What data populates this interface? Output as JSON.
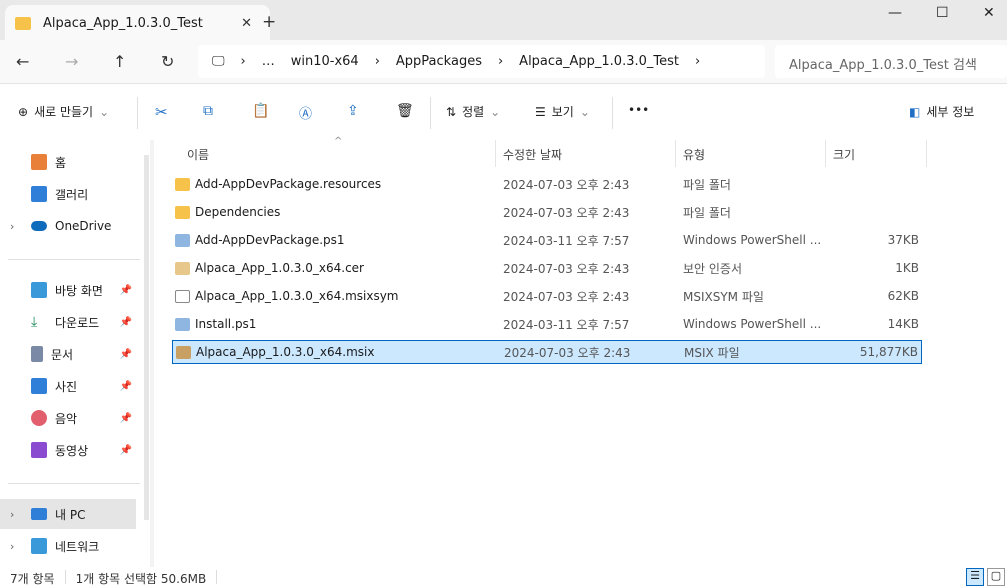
{
  "window": {
    "tab_title": "Alpaca_App_1.0.3.0_Test",
    "new_tab": "+",
    "minimize": "—",
    "maximize": "☐",
    "close": "✕"
  },
  "breadcrumb": [
    "…",
    "win10-x64",
    "AppPackages",
    "Alpaca_App_1.0.3.0_Test"
  ],
  "search": {
    "placeholder": "Alpaca_App_1.0.3.0_Test 검색"
  },
  "toolbar": {
    "new": "새로 만들기",
    "sort": "정렬",
    "view": "보기",
    "more": "•••",
    "details": "세부 정보"
  },
  "sidebar": {
    "items": [
      {
        "label": "홈",
        "color": "#e8803a"
      },
      {
        "label": "갤러리",
        "color": "#2f7fd8"
      },
      {
        "label": "OneDrive",
        "color": "#0f6cbd"
      },
      {
        "label": "바탕 화면",
        "color": "#3a9ad9"
      },
      {
        "label": "다운로드",
        "color": "#1b8a5a"
      },
      {
        "label": "문서",
        "color": "#7a8aa6"
      },
      {
        "label": "사진",
        "color": "#2f7fd8"
      },
      {
        "label": "음악",
        "color": "#e2606d"
      },
      {
        "label": "동영상",
        "color": "#8a4bd1"
      },
      {
        "label": "내 PC",
        "color": "#2f7fd8"
      },
      {
        "label": "네트워크",
        "color": "#3a9ad9"
      }
    ]
  },
  "columns": {
    "name": "이름",
    "date": "수정한 날짜",
    "type": "유형",
    "size": "크기"
  },
  "files": [
    {
      "name": "Add-AppDevPackage.resources",
      "date": "2024-07-03 오후 2:43",
      "type": "파일 폴더",
      "size": "",
      "icon": "folder"
    },
    {
      "name": "Dependencies",
      "date": "2024-07-03 오후 2:43",
      "type": "파일 폴더",
      "size": "",
      "icon": "folder"
    },
    {
      "name": "Add-AppDevPackage.ps1",
      "date": "2024-03-11 오후 7:57",
      "type": "Windows PowerShell ...",
      "size": "37KB",
      "icon": "ps1"
    },
    {
      "name": "Alpaca_App_1.0.3.0_x64.cer",
      "date": "2024-07-03 오후 2:43",
      "type": "보안 인증서",
      "size": "1KB",
      "icon": "cert"
    },
    {
      "name": "Alpaca_App_1.0.3.0_x64.msixsym",
      "date": "2024-07-03 오후 2:43",
      "type": "MSIXSYM 파일",
      "size": "62KB",
      "icon": "file"
    },
    {
      "name": "Install.ps1",
      "date": "2024-03-11 오후 7:57",
      "type": "Windows PowerShell ...",
      "size": "14KB",
      "icon": "ps1"
    },
    {
      "name": "Alpaca_App_1.0.3.0_x64.msix",
      "date": "2024-07-03 오후 2:43",
      "type": "MSIX 파일",
      "size": "51,877KB",
      "icon": "package",
      "selected": true
    }
  ],
  "status": {
    "count": "7개 항목",
    "selection": "1개 항목 선택함 50.6MB"
  }
}
